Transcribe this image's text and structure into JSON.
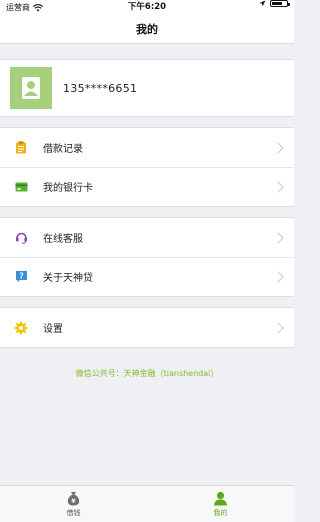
{
  "status_bar": {
    "carrier": "运营商",
    "time": "下午6:20",
    "battery_level": 0.7
  },
  "nav": {
    "title": "我的"
  },
  "profile": {
    "phone": "135****6651"
  },
  "menu_groups": [
    [
      {
        "label": "借款记录",
        "icon": "clipboard-icon",
        "color": "#f0b418"
      },
      {
        "label": "我的银行卡",
        "icon": "card-icon",
        "color": "#57b437"
      }
    ],
    [
      {
        "label": "在线客服",
        "icon": "headset-icon",
        "color": "#8c3ec4"
      },
      {
        "label": "关于天神贷",
        "icon": "question-icon",
        "color": "#3a8fd8"
      }
    ],
    [
      {
        "label": "设置",
        "icon": "gear-icon",
        "color": "#f2c400"
      }
    ]
  ],
  "wechat_note": "微信公共号：天神金融（tianshendai）",
  "tabs": [
    {
      "label": "借钱",
      "icon": "money-bag-icon",
      "active": false
    },
    {
      "label": "我的",
      "icon": "person-icon",
      "active": true
    }
  ],
  "colors": {
    "accent": "#5fa91e",
    "avatar_bg": "#a7d07c",
    "page_bg": "#efeff4"
  }
}
